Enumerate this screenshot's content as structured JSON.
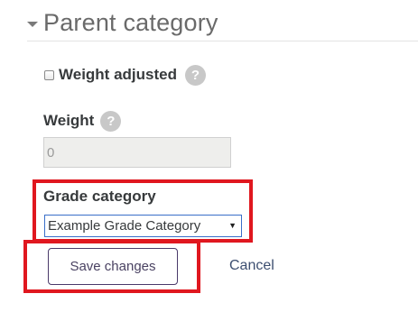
{
  "section": {
    "title": "Parent category",
    "caret_icon": "caret-down-icon"
  },
  "weight_adjusted": {
    "label": "Weight adjusted",
    "checked": false,
    "help_icon": "help-icon",
    "help_glyph": "?"
  },
  "weight": {
    "label": "Weight",
    "help_icon": "help-icon",
    "help_glyph": "?",
    "placeholder": "0",
    "disabled": true
  },
  "grade_category": {
    "label": "Grade category",
    "selected": "Example Grade Category",
    "arrow_glyph": "▼"
  },
  "actions": {
    "save_label": "Save changes",
    "cancel_label": "Cancel"
  },
  "colors": {
    "highlight": "#e0171f",
    "select_border": "#3a6fc9",
    "help_icon_bg": "#c8c8c8",
    "link": "#3c4e70"
  }
}
